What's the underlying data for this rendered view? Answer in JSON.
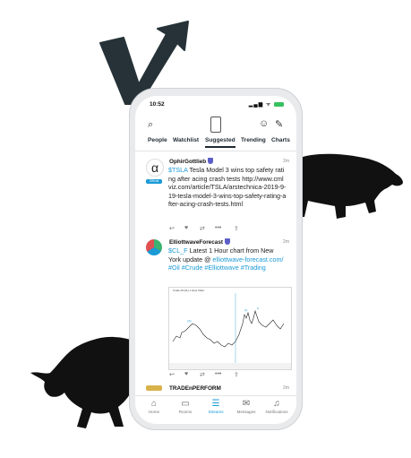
{
  "brand": {
    "logo_name": "stocktwits-logo",
    "color": "#263238"
  },
  "status_bar": {
    "time": "10:52",
    "icons": "▂▄▆ ᯤ"
  },
  "tabs": [
    "People",
    "Watchlist",
    "Suggested",
    "Trending",
    "Charts"
  ],
  "active_tab": "Suggested",
  "posts": [
    {
      "user": "OphirGottlieb",
      "time": "2m",
      "badge": "Official",
      "avatar_letter": "α",
      "cashtag": "$TSLA",
      "text": " Tesla Model 3 wins top safety rating after acing crash tests http://www.cmlviz.com/article/TSLA/arstechnica-2019-9-19-tesla-model-3-wins-top-safety-rating-after-acing-crash-tests.html"
    },
    {
      "user": "ElliottwaveForecast",
      "time": "2m",
      "cashtag": "$CL_F",
      "text": " Latest 1 Hour chart from New York update @ ",
      "link": "elliottwave-forecast.com/ #Oil #Crude #Elliottwave #Trading",
      "chart_title": "Crude Oil (CL) 1 Hour Chart"
    },
    {
      "user": "TRADEnPERFORM",
      "time": "2m"
    }
  ],
  "bottom_nav": [
    {
      "label": "Home",
      "icon": "home-icon"
    },
    {
      "label": "Rooms",
      "icon": "rooms-icon"
    },
    {
      "label": "Streams",
      "icon": "streams-icon"
    },
    {
      "label": "Messages",
      "icon": "messages-icon"
    },
    {
      "label": "Notifications",
      "icon": "notifications-icon"
    }
  ],
  "active_nav": "Streams",
  "accent": "#1a9ad6",
  "bull_bear_color": "#111111"
}
